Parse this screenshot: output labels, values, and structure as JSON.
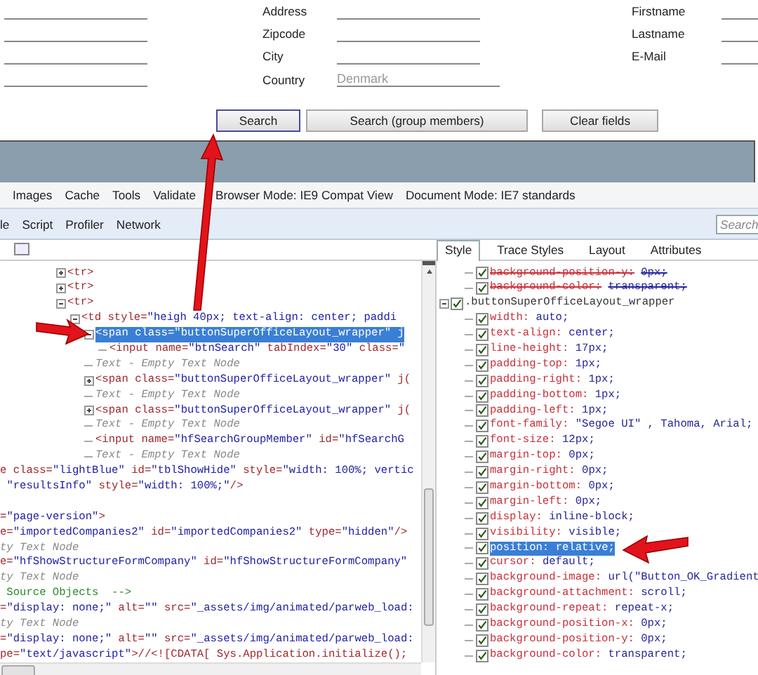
{
  "search_form": {
    "left_fields": [
      {
        "kind": "input"
      },
      {
        "kind": "input"
      },
      {
        "kind": "input"
      },
      {
        "kind": "input"
      }
    ],
    "middle_fields": [
      {
        "label": "Address"
      },
      {
        "label": "Zipcode"
      },
      {
        "label": "City"
      },
      {
        "label": "Country",
        "placeholder": "Denmark"
      }
    ],
    "right_fields": [
      {
        "label": "Firstname"
      },
      {
        "label": "Lastname"
      },
      {
        "label": "E-Mail"
      }
    ],
    "buttons": [
      {
        "label": "Search",
        "focused": true
      },
      {
        "label": "Search (group members)",
        "focused": false
      },
      {
        "label": "Clear fields",
        "focused": false
      }
    ]
  },
  "devtools": {
    "menu": [
      "Images",
      "Cache",
      "Tools",
      "Validate"
    ],
    "modes": [
      "Browser Mode: IE9 Compat View",
      "Document Mode: IE7 standards"
    ],
    "tabs": [
      {
        "label": "le"
      },
      {
        "label": "Script"
      },
      {
        "label": "Profiler"
      },
      {
        "label": "Network"
      }
    ],
    "search": {
      "placeholder": "Search"
    },
    "dom_tree": [
      {
        "kind": "element",
        "text": "<tr>",
        "expanded": false,
        "selected": false
      },
      {
        "kind": "element",
        "text": "<tr>",
        "expanded": false,
        "selected": false
      },
      {
        "kind": "element",
        "text": "<tr>",
        "expanded": true,
        "selected": false,
        "children": [
          {
            "kind": "element",
            "text": "<td style=\"heigh  40px; text-align: center; paddi",
            "expanded": true,
            "selected": false,
            "children": [
              {
                "kind": "element",
                "text": "<span class=\"buttonSuperOfficeLayout_wrapper\" j",
                "expanded": true,
                "selected": true,
                "children": [
                  {
                    "kind": "element",
                    "text": "<input name=\"btnSearch\" tabIndex=\"30\" class=\"",
                    "selected": false
                  }
                ]
              },
              {
                "kind": "text",
                "text": "Text - Empty Text Node",
                "selected": false
              },
              {
                "kind": "element",
                "text": "<span class=\"buttonSuperOfficeLayout_wrapper\" j(",
                "expanded": false,
                "selected": false
              },
              {
                "kind": "text",
                "text": "Text - Empty Text Node",
                "selected": false
              },
              {
                "kind": "element",
                "text": "<span class=\"buttonSuperOfficeLayout_wrapper\" j(",
                "expanded": false,
                "selected": false
              },
              {
                "kind": "text",
                "text": "Text - Empty Text Node",
                "selected": false
              },
              {
                "kind": "element",
                "text": "<input name=\"hfSearchGroupMember\" id=\"hfSearchG",
                "selected": false
              },
              {
                "kind": "text",
                "text": "Text - Empty Text Node",
                "selected": false
              }
            ]
          }
        ]
      }
    ],
    "cut_lines": [
      {
        "kind": "element",
        "text": "e class=\"lightBlue\" id=\"tblShowHide\" style=\"width: 100%; vertic"
      },
      {
        "kind": "element",
        "text": " \"resultsInfo\" style=\"width: 100%;\"/>"
      },
      {
        "kind": "element",
        "text": "=\"page-version\">",
        "gap_before": true
      },
      {
        "kind": "element",
        "text": "e=\"importedCompanies2\" id=\"importedCompanies2\" type=\"hidden\"/>"
      },
      {
        "kind": "text",
        "text": "ty Text Node"
      },
      {
        "kind": "element",
        "text": "e=\"hfShowStructureFormCompany\" id=\"hfShowStructureFormCompany\""
      },
      {
        "kind": "text",
        "text": "ty Text Node"
      },
      {
        "kind": "comment",
        "text": " Source Objects  -->"
      },
      {
        "kind": "element",
        "text": "=\"display: none;\" alt=\"\" src=\"_assets/img/animated/parweb_load:"
      },
      {
        "kind": "text",
        "text": "ty Text Node"
      },
      {
        "kind": "element",
        "text": "=\"display: none;\" alt=\"\" src=\"_assets/img/animated/parweb_load:"
      },
      {
        "kind": "element",
        "text": "pe=\"text/javascript\">//<![CDATA[ Sys.Application.initialize();"
      }
    ],
    "style_tabs": [
      {
        "label": "Style",
        "selected": true
      },
      {
        "label": "Trace Styles",
        "selected": false
      },
      {
        "label": "Layout",
        "selected": false
      },
      {
        "label": "Attributes",
        "selected": false
      }
    ],
    "style_pane": {
      "inherited": [
        {
          "property": "background-position-y:",
          "value": "0px;",
          "checked": true,
          "overridden": true,
          "selected": false
        },
        {
          "property": "background-color:",
          "value": "transparent;",
          "checked": true,
          "overridden": true,
          "selected": false
        }
      ],
      "rules": [
        {
          "selector": ".buttonSuperOfficeLayout_wrapper",
          "checked": true,
          "expanded": true,
          "declarations": [
            {
              "property": "width:",
              "value": "auto;",
              "checked": true,
              "overridden": false,
              "selected": false
            },
            {
              "property": "text-align:",
              "value": "center;",
              "checked": true,
              "overridden": false,
              "selected": false
            },
            {
              "property": "line-height:",
              "value": "17px;",
              "checked": true,
              "overridden": false,
              "selected": false
            },
            {
              "property": "padding-top:",
              "value": "1px;",
              "checked": true,
              "overridden": false,
              "selected": false
            },
            {
              "property": "padding-right:",
              "value": "1px;",
              "checked": true,
              "overridden": false,
              "selected": false
            },
            {
              "property": "padding-bottom:",
              "value": "1px;",
              "checked": true,
              "overridden": false,
              "selected": false
            },
            {
              "property": "padding-left:",
              "value": "1px;",
              "checked": true,
              "overridden": false,
              "selected": false
            },
            {
              "property": "font-family:",
              "value": "\"Segoe UI\" , Tahoma, Arial;",
              "checked": true,
              "overridden": false,
              "selected": false
            },
            {
              "property": "font-size:",
              "value": "12px;",
              "checked": true,
              "overridden": false,
              "selected": false
            },
            {
              "property": "margin-top:",
              "value": "0px;",
              "checked": true,
              "overridden": false,
              "selected": false
            },
            {
              "property": "margin-right:",
              "value": "0px;",
              "checked": true,
              "overridden": false,
              "selected": false
            },
            {
              "property": "margin-bottom:",
              "value": "0px;",
              "checked": true,
              "overridden": false,
              "selected": false
            },
            {
              "property": "margin-left:",
              "value": "0px;",
              "checked": true,
              "overridden": false,
              "selected": false
            },
            {
              "property": "display:",
              "value": "inline-block;",
              "checked": true,
              "overridden": false,
              "selected": false
            },
            {
              "property": "visibility:",
              "value": "visible;",
              "checked": true,
              "overridden": false,
              "selected": false
            },
            {
              "property": "position:",
              "value": "relative;",
              "checked": true,
              "overridden": false,
              "selected": true
            },
            {
              "property": "cursor:",
              "value": "default;",
              "checked": true,
              "overridden": false,
              "selected": false
            },
            {
              "property": "background-image:",
              "value": "url(\"Button_OK_Gradient",
              "checked": true,
              "overridden": false,
              "selected": false
            },
            {
              "property": "background-attachment:",
              "value": "scroll;",
              "checked": true,
              "overridden": false,
              "selected": false
            },
            {
              "property": "background-repeat:",
              "value": "repeat-x;",
              "checked": true,
              "overridden": false,
              "selected": false
            },
            {
              "property": "background-position-x:",
              "value": "0px;",
              "checked": true,
              "overridden": false,
              "selected": false
            },
            {
              "property": "background-position-y:",
              "value": "0px;",
              "checked": true,
              "overridden": false,
              "selected": false
            },
            {
              "property": "background-color:",
              "value": "transparent;",
              "checked": true,
              "overridden": false,
              "selected": false
            }
          ]
        }
      ]
    }
  },
  "annotations": [
    {
      "kind": "arrow"
    },
    {
      "kind": "arrow"
    },
    {
      "kind": "arrow"
    }
  ]
}
